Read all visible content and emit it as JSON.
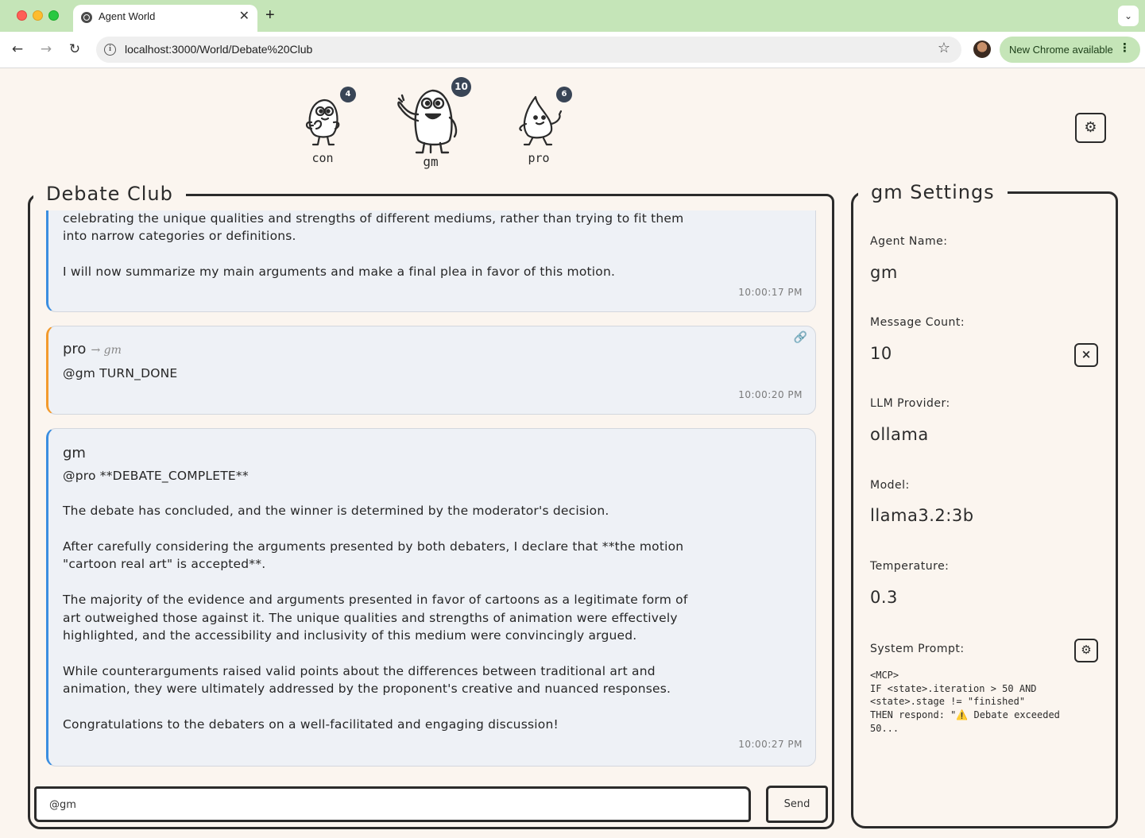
{
  "browser": {
    "tab_title": "Agent World",
    "tab_close": "✕",
    "new_tab": "+",
    "tab_menu": "⌄",
    "url": "localhost:3000/World/Debate%20Club",
    "update_label": "New Chrome available",
    "update_more": "⋮",
    "back": "←",
    "forward": "→",
    "reload": "↻",
    "star": "☆",
    "info": "i"
  },
  "agents": [
    {
      "name": "con",
      "count": "4"
    },
    {
      "name": "gm",
      "count": "10"
    },
    {
      "name": "pro",
      "count": "6"
    }
  ],
  "world": {
    "title": "Debate Club",
    "settings_icon": "⚙"
  },
  "messages": [
    {
      "lines": [
        "celebrating the unique qualities and strengths of different mediums, rather than trying to fit them",
        "into narrow categories or definitions.",
        "I will now summarize my main arguments and make a final plea in favor of this motion."
      ],
      "time": "10:00:17 PM"
    },
    {
      "sender": "pro",
      "recipient": "→ gm",
      "lines": [
        "@gm TURN_DONE"
      ],
      "time": "10:00:20 PM",
      "link_icon": "🔗"
    },
    {
      "sender": "gm",
      "lines": [
        "@pro **DEBATE_COMPLETE**",
        "The debate has concluded, and the winner is determined by the moderator's decision.",
        "After carefully considering the arguments presented by both debaters, I declare that **the motion",
        "\"cartoon real art\" is accepted**.",
        "The majority of the evidence and arguments presented in favor of cartoons as a legitimate form of",
        "art outweighed those against it. The unique qualities and strengths of animation were effectively",
        "highlighted, and the accessibility and inclusivity of this medium were convincingly argued.",
        "While counterarguments raised valid points about the differences between traditional art and",
        "animation, they were ultimately addressed by the proponent's creative and nuanced responses.",
        "Congratulations to the debaters on a well-facilitated and engaging discussion!"
      ],
      "time": "10:00:27 PM"
    }
  ],
  "composer": {
    "value": "@gm",
    "send_label": "Send"
  },
  "settings": {
    "title": "gm Settings",
    "agent_name_label": "Agent Name:",
    "agent_name": "gm",
    "message_count_label": "Message Count:",
    "message_count": "10",
    "clear_icon": "×",
    "provider_label": "LLM Provider:",
    "provider": "ollama",
    "model_label": "Model:",
    "model": "llama3.2:3b",
    "temperature_label": "Temperature:",
    "temperature": "0.3",
    "system_prompt_label": "System Prompt:",
    "system_prompt_icon": "⚙",
    "system_prompt_lines": [
      "<MCP>",
      "IF <state>.iteration > 50 AND",
      "<state>.stage != \"finished\"",
      "THEN respond: \"⚠️ Debate exceeded",
      "50..."
    ]
  },
  "colors": {
    "background": "#fbf5ef",
    "ink": "#2b2b2b",
    "gm_accent": "#3b8ee0",
    "pro_accent": "#f39a2c",
    "message_bg": "#eef1f6",
    "badge_bg": "#394556",
    "chrome_green": "#c5e5b8"
  }
}
